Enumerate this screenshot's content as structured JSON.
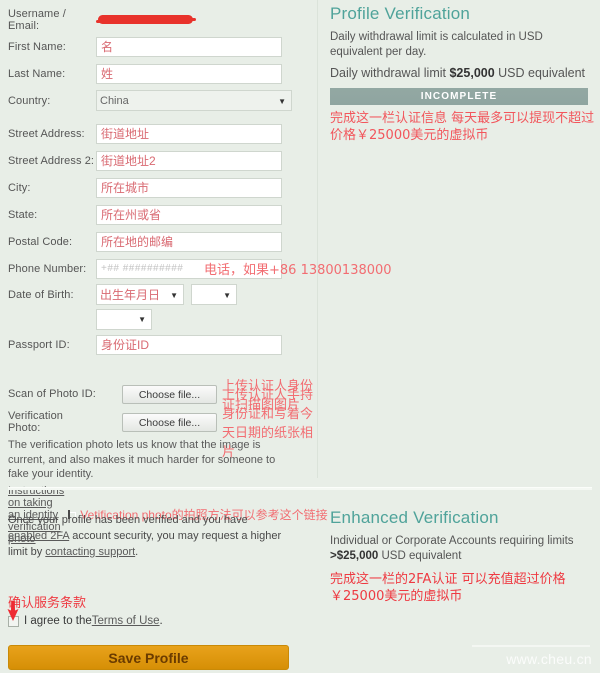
{
  "form": {
    "rows": [
      {
        "label": "Username / Email:",
        "type": "redacted",
        "value": ""
      },
      {
        "label": "First Name:",
        "type": "text",
        "value": "名"
      },
      {
        "label": "Last Name:",
        "type": "text",
        "value": "姓"
      },
      {
        "label": "Country:",
        "type": "select",
        "value": "China"
      },
      {
        "label": "Street Address:",
        "type": "text",
        "value": "街道地址"
      },
      {
        "label": "Street Address 2:",
        "type": "text",
        "value": "街道地址2"
      },
      {
        "label": "City:",
        "type": "text",
        "value": "所在城市"
      },
      {
        "label": "State:",
        "type": "text",
        "value": "所在州或省"
      },
      {
        "label": "Postal Code:",
        "type": "text",
        "value": "所在地的邮编"
      }
    ],
    "phone": {
      "label": "Phone Number:",
      "placeholder": "+## ##########",
      "annotation": "电话，如果+86 13800138000"
    },
    "dob": {
      "label": "Date of Birth:",
      "day_value": "出生年月日",
      "month_value": "",
      "year_value": ""
    },
    "passport": {
      "label": "Passport ID:",
      "value": "身份证ID"
    },
    "scan_id": {
      "label": "Scan of Photo ID:",
      "button": "Choose file...",
      "annotation": "上传认证人身份证扫描图图片"
    },
    "verification_photo": {
      "label": "Verification Photo:",
      "button": "Choose file...",
      "annotation": "上传认证人手持身份证和写着今天日期的纸张相片"
    },
    "help_text": "The verification photo lets us know that the image is current, and also makes it much harder for someone to fake your identity.",
    "instructions_link": "Instructions on taking an identity verification photo",
    "instructions_annotation": "Vetification photo的拍照方法可以参考这个链接"
  },
  "profile_verification": {
    "title": "Profile Verification",
    "description": "Daily withdrawal limit is calculated in USD equivalent per day.",
    "limit_prefix": "Daily withdrawal limit ",
    "limit_amount": "$25,000",
    "limit_suffix": " USD equivalent",
    "status_badge": "INCOMPLETE",
    "annotation": "完成这一栏认证信息 每天最多可以提现不超过价格￥25000美元的虚拟币"
  },
  "enhanced_verification": {
    "title": "Enhanced Verification",
    "description_prefix": "Individual or Corporate Accounts requiring limits ",
    "limit_amount": ">$25,000",
    "description_suffix": " USD equivalent",
    "annotation": "完成这一栏的2FA认证 可以充值超过价格￥25000美元的虚拟币"
  },
  "footer": {
    "upgrade_text_1": "Once your profile has been verified and you have ",
    "upgrade_link_1": "enabled 2FA",
    "upgrade_text_2": " account security, you may request a higher limit by ",
    "upgrade_link_2": "contacting support",
    "upgrade_text_3": ".",
    "terms_annotation": "确认服务条款",
    "agree_text_1": "I agree to the ",
    "agree_link": "Terms of Use",
    "agree_text_2": ".",
    "save_button": "Save Profile"
  },
  "watermark": "www.cheu.cn",
  "colors": {
    "background": "#e8eee7",
    "heading_teal": "#4fa39a",
    "annotation_red": "#f26d72",
    "save_button_orange": "#e8a21b",
    "badge_gray": "#93a8a3"
  }
}
